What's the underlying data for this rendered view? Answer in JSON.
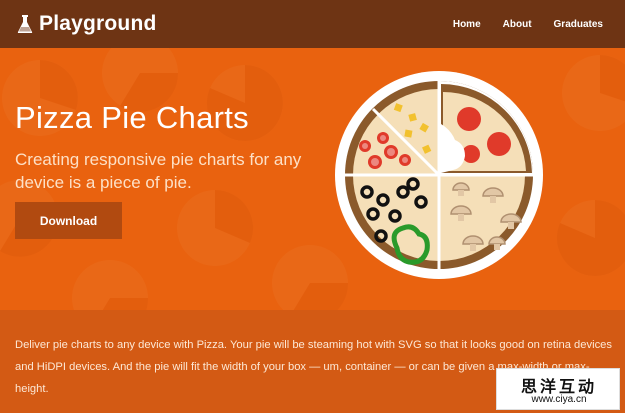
{
  "header": {
    "brand": "Playground",
    "nav": [
      "Home",
      "About",
      "Graduates"
    ]
  },
  "hero": {
    "title": "Pizza Pie Charts",
    "subtitle": "Creating responsive pie charts for any device is a piece of pie.",
    "button_label": "Download"
  },
  "description": "Deliver pie charts to any device with Pizza. Your pie will be steaming hot with SVG so that it looks good on retina devices and HiDPI devices. And the pie will fit the width of your box — um, container — or can be given a max-width or max-height.",
  "watermark": {
    "text": "思洋互动",
    "url": "www.ciya.cn"
  },
  "icons": {
    "brand": "flask-icon"
  },
  "colors": {
    "topbar": "#6e3414",
    "hero": "#e9620f",
    "footer": "#d35a14",
    "button": "#b14a10",
    "crust": "#8b5a2b",
    "cheese": "#f5dfb8",
    "sauce": "#e03a2a"
  }
}
